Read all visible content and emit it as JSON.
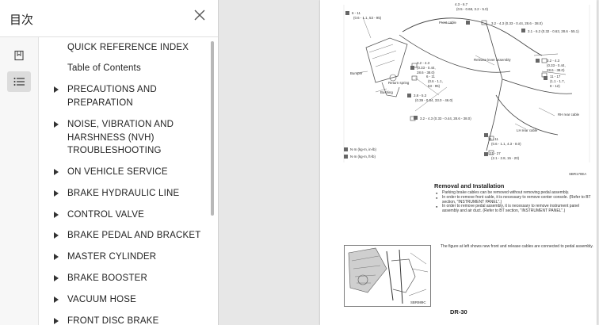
{
  "sidebar": {
    "title": "目次",
    "toc": [
      {
        "label": "QUICK REFERENCE INDEX",
        "expandable": false
      },
      {
        "label": "Table of Contents",
        "expandable": false
      },
      {
        "label": "PRECAUTIONS AND PREPARATION",
        "expandable": true
      },
      {
        "label": "NOISE, VIBRATION AND HARSHNESS (NVH) TROUBLESHOOTING",
        "expandable": true
      },
      {
        "label": "ON VEHICLE SERVICE",
        "expandable": true
      },
      {
        "label": "BRAKE HYDRAULIC LINE",
        "expandable": true
      },
      {
        "label": "CONTROL VALVE",
        "expandable": true
      },
      {
        "label": "BRAKE PEDAL AND BRACKET",
        "expandable": true
      },
      {
        "label": "MASTER CYLINDER",
        "expandable": true
      },
      {
        "label": "BRAKE BOOSTER",
        "expandable": true
      },
      {
        "label": "VACUUM HOSE",
        "expandable": true
      },
      {
        "label": "FRONT DISC BRAKE",
        "expandable": true
      }
    ]
  },
  "page": {
    "heading": "Removal and Installation",
    "bullets": [
      "Parking brake cables can be removed without removing pedal assembly.",
      "In order to remove front cable, it is necessary to remove center console. (Refer to BT section, \"INSTRUMENT PANEL\".)",
      "In order to remove pedal assembly, it is necessary to remove instrument panel assembly and air duct. (Refer to BT section, \"INSTRUMENT PANEL\".)"
    ],
    "figure_note": "The figure at left shows new front and release cables are connected to pedal assembly.",
    "page_number": "DR-30",
    "diagram_labels": {
      "bumper": "Bumper",
      "return_spring": "Return spring",
      "bushing": "Bushing",
      "front_cable": "Front cable",
      "release_lever": "Release lever assembly",
      "rh_rear_cable": "RH rear cable",
      "lh_rear_cable": "LH rear cable",
      "legend_1": "N·m (kg-m, in-lb)",
      "legend_2": "N·m (kg-m, ft-lb)",
      "t1": "6 - 11",
      "t1b": "(0.6 - 1.1, 53 - 95)",
      "t2": "4.3 - 6.7",
      "t2b": "(0.5 - 0.68, 3.2 - 5.0)",
      "t3": "3.2 - 4.3 (0.33 - 0.44, 28.6 - 38.0)",
      "t4": "3.1 - 6.2 (0.32 - 0.63, 28.6 - 55.1)",
      "t5": "3.2 - 4.3",
      "t5b": "(0.33 - 0.44,",
      "t5c": "28.6 - 38.0)",
      "t6": "6 - 11",
      "t6b": "(0.6 - 1.1,",
      "t6c": "53 - 95)",
      "t7": "3.8 - 5.3",
      "t7b": "(0.39 - 0.54, 33.0 - 46.0)",
      "t8": "3.2 - 4.3 (0.33 - 0.44, 28.6 - 38.0)",
      "t9": "6 - 11",
      "t9b": "(0.6 - 1.1, 4.3 - 8.0)",
      "t10": "21 - 27",
      "t10b": "(2.1 - 2.8, 15 - 20)",
      "t11": "3.2 - 4.3",
      "t11b": "(0.33 - 0.44,",
      "t11c": "28.6 - 38.0)",
      "t12": "11 - 17",
      "t12b": "(1.1 - 1.7,",
      "t12c": "8 - 12)",
      "code1": "SBR170EA",
      "code2": "SBR989C"
    }
  }
}
